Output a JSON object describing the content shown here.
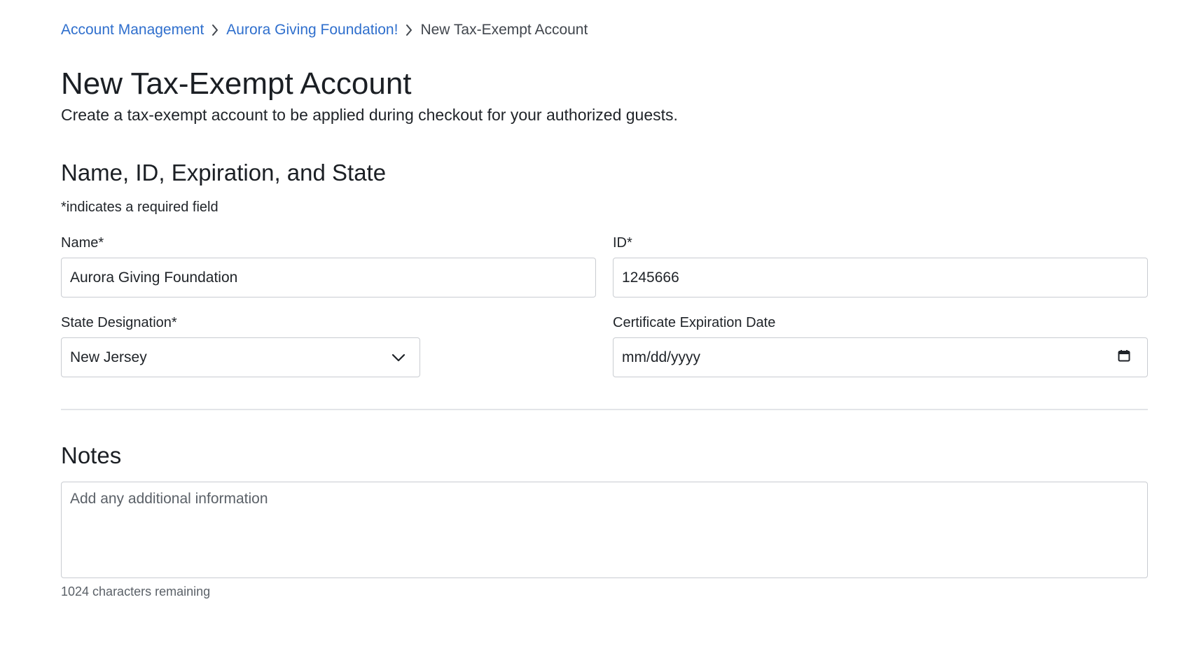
{
  "breadcrumb": {
    "items": [
      {
        "label": "Account Management"
      },
      {
        "label": "Aurora Giving Foundation!"
      },
      {
        "label": "New Tax-Exempt Account"
      }
    ]
  },
  "header": {
    "title": "New Tax-Exempt Account",
    "subtitle": "Create a tax-exempt account to be applied during checkout for your authorized guests."
  },
  "section_details": {
    "title": "Name, ID, Expiration, and State",
    "required_note": "*indicates a required field",
    "name_field": {
      "label": "Name*",
      "value": "Aurora Giving Foundation"
    },
    "id_field": {
      "label": "ID*",
      "value": "1245666"
    },
    "state_field": {
      "label": "State Designation*",
      "value": "New Jersey",
      "icon": "chevron-down-icon"
    },
    "expiration_field": {
      "label": "Certificate Expiration Date",
      "placeholder": "mm/dd/yyyy",
      "icon": "calendar-icon"
    }
  },
  "section_notes": {
    "title": "Notes",
    "placeholder": "Add any additional information",
    "char_count": "1024 characters remaining"
  },
  "colors": {
    "link": "#2f6fcd",
    "border": "#c9ccd1",
    "divider": "#e3e5e8"
  }
}
